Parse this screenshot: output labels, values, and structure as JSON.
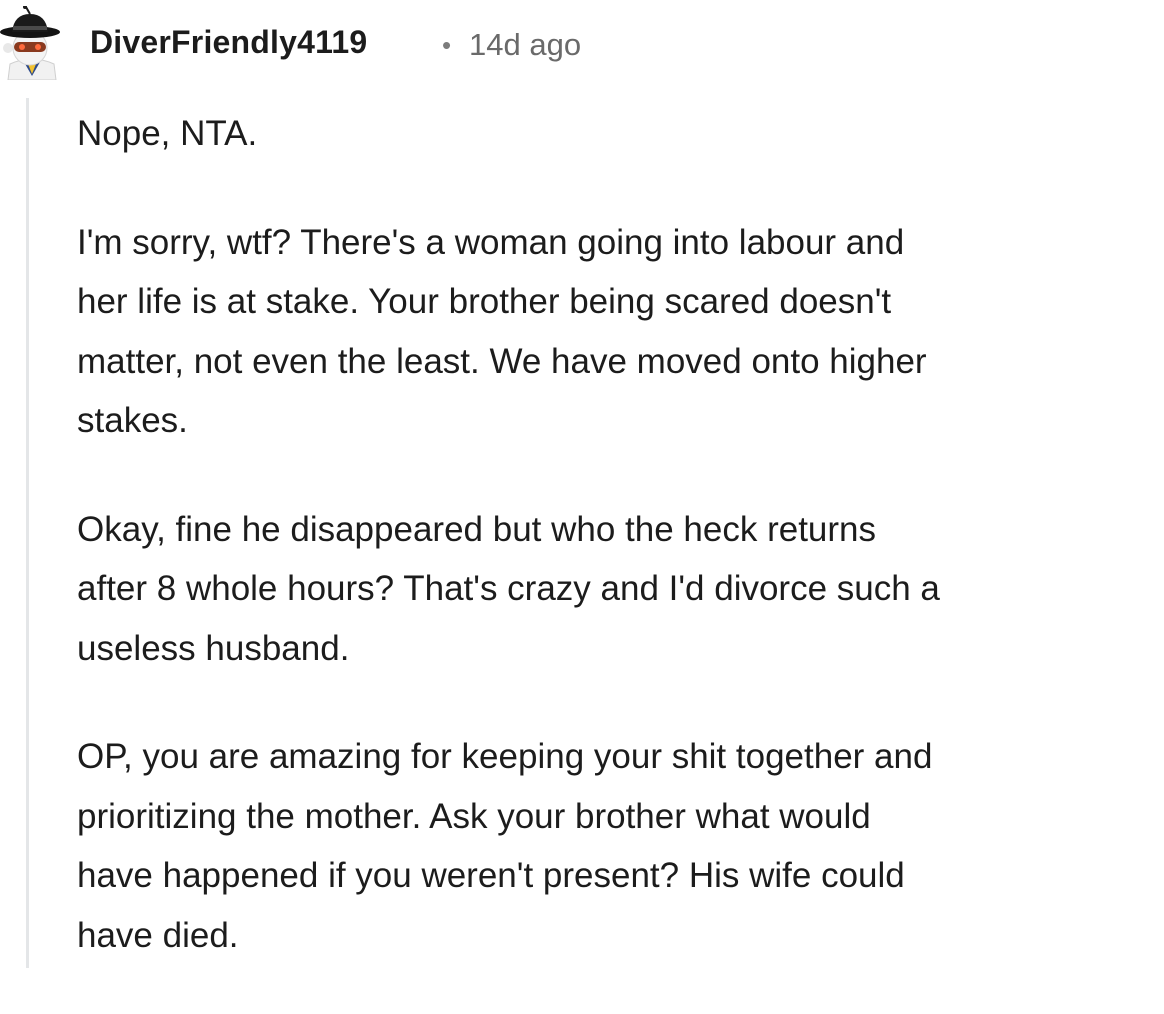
{
  "comment": {
    "author": "DiverFriendly4119",
    "separator": "•",
    "time": "14d ago",
    "avatar_icon": "snoo-avatar-with-hat-icon",
    "paragraphs": [
      {
        "lines": [
          "Nope, NTA."
        ]
      },
      {
        "lines": [
          "I'm sorry, wtf? There's a woman going into labour and",
          "her life is at stake. Your brother being scared doesn't",
          "matter, not even the least. We have moved onto higher",
          "stakes."
        ]
      },
      {
        "lines": [
          "Okay, fine he disappeared but who the heck returns",
          "after 8 whole hours? That's crazy and I'd divorce such a",
          "useless husband."
        ]
      },
      {
        "lines": [
          "OP, you are amazing for keeping your shit together and",
          "prioritizing the mother. Ask your brother what would",
          "have happened if you weren't present? His wife could",
          "have died."
        ]
      }
    ]
  },
  "colors": {
    "text": "#1c1c1c",
    "meta": "#6a6a6a",
    "thread_line": "#e4e6e8"
  }
}
